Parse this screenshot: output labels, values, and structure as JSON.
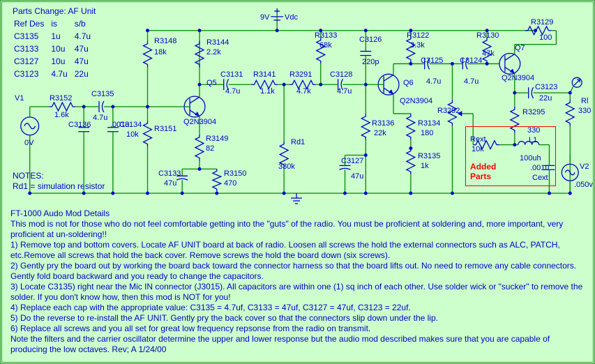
{
  "parts_change": {
    "title": "Parts Change: AF Unit",
    "header": {
      "ref": "Ref Des",
      "is": "is",
      "sb": "s/b"
    },
    "rows": [
      {
        "ref": "C3135",
        "is": "1u",
        "sb": "4.7u"
      },
      {
        "ref": "C3133",
        "is": "10u",
        "sb": "47u"
      },
      {
        "ref": "C3127",
        "is": "10u",
        "sb": "47u"
      },
      {
        "ref": "C3123",
        "is": "4.7u",
        "sb": "22u"
      }
    ]
  },
  "notes": {
    "title": "NOTES:",
    "line1": "Rd1 = simulation resistor"
  },
  "supply": {
    "label": "9V",
    "vdc": "Vdc"
  },
  "components": {
    "V1": {
      "name": "V1",
      "sub": "0V"
    },
    "V2": {
      "name": "V2",
      "sub": ".050v"
    },
    "R3152": {
      "name": "R3152",
      "val": "1.6k"
    },
    "C3135": {
      "name": "C3135",
      "val": "4.7u"
    },
    "C3136": {
      "name": "C3136",
      "val": ".001u"
    },
    "C3134": {
      "name": "C3134",
      "val": "10k"
    },
    "R3148": {
      "name": "R3148",
      "val": "18k"
    },
    "R3151": {
      "name": "R3151"
    },
    "R3149": {
      "name": "R3149",
      "val": "82"
    },
    "C3133": {
      "name": "C3133",
      "val": "47u"
    },
    "R3150": {
      "name": "R3150",
      "val": "470"
    },
    "R3144": {
      "name": "R3144",
      "val": "2.2k"
    },
    "Q5": {
      "name": "Q5",
      "val": "Q2N3904"
    },
    "C3131": {
      "name": "C3131",
      "val": "4.7u"
    },
    "R3141": {
      "name": "R3141",
      "val": "1.1k"
    },
    "R3291": {
      "name": "R3291",
      "val": "4.7k"
    },
    "Rd1": {
      "name": "Rd1",
      "val": "330k"
    },
    "C3128": {
      "name": "C3128",
      "val": "4.7u"
    },
    "R3133": {
      "name": "R3133",
      "val": "68k"
    },
    "C3126": {
      "name": "C3126",
      "val": "220p"
    },
    "R3136": {
      "name": "R3136",
      "val": "22k"
    },
    "C3127": {
      "name": "C3127",
      "val": "47u"
    },
    "Q6": {
      "name": "Q6",
      "val": "Q2N3904"
    },
    "R3122": {
      "name": "R3122",
      "val": "3.3k"
    },
    "C3125": {
      "name": "C3125",
      "val": "4.7u"
    },
    "R3134": {
      "name": "R3134",
      "val": "180"
    },
    "R3135": {
      "name": "R3135",
      "val": "1k"
    },
    "R3292": {
      "name": "R3292"
    },
    "C3124": {
      "name": "C3124",
      "val": "4.7u"
    },
    "R3130": {
      "name": "R3130",
      "val": "47k"
    },
    "Q7": {
      "name": "Q7",
      "val": "Q2N3904"
    },
    "R3129": {
      "name": "R3129",
      "val": "100"
    },
    "C3123": {
      "name": "C3123",
      "val": "22u"
    },
    "R3295": {
      "name": "R3295",
      "val": "330"
    },
    "Rl": {
      "name": "Rl",
      "val": "330"
    },
    "Rext": {
      "name": "Rext",
      "val": "10k"
    },
    "L1": {
      "name": "L1",
      "val": "100uh"
    },
    "Cext": {
      "name": "Cext",
      "val": ".001u"
    }
  },
  "added_parts_label": "Added\nParts",
  "details": {
    "title": "FT-1000 Audo Mod Details",
    "intro": "This mod is not for those who do not feel comfortable getting into the \"guts\" of the radio. You must be proficient at soldering and, more important, very proficient at un-soldering!!",
    "step1": "1) Remove top and bottom covers. Locate AF UNIT board at back of radio. Loosen all screws the hold the external connectors such as ALC, PATCH, etc.Remove all screws that hold the back cover.  Remove screws the hold the board down (six screws).",
    "step2": "2) Gently pry the board out by working the board back toward the connector harness so that the board lifts out. No need to remove any cable connectors. Gently fold board backward and you ready to change the capacitors.",
    "step3": "3) Locate C3135) right near the Mic IN connector (J3015). All capacitors are within one (1) sq inch of each other. Use solder wick or \"sucker\" to remove the solder. If you don't know how, then this mod is NOT for you!",
    "step4": "4) Replace each cap with the appropriate value: C3135 = 4.7uf, C3133 = 47uf, C3127 = 47uf, C3123 = 22uf.",
    "step5": "5) Do the reverse to re-install the AF UNIT. Gently pry the back cover so that the connectors slip down under the lip.",
    "step6": "6) Replace all screws and you all set for great low frequency repsonse from the radio on transmit.",
    "note": "Note the filters and the carrier oscillator determine the upper and lower response but the audio mod described makes sure that you are capable of producing the low octaves.        Rev; A  1/24/00"
  }
}
